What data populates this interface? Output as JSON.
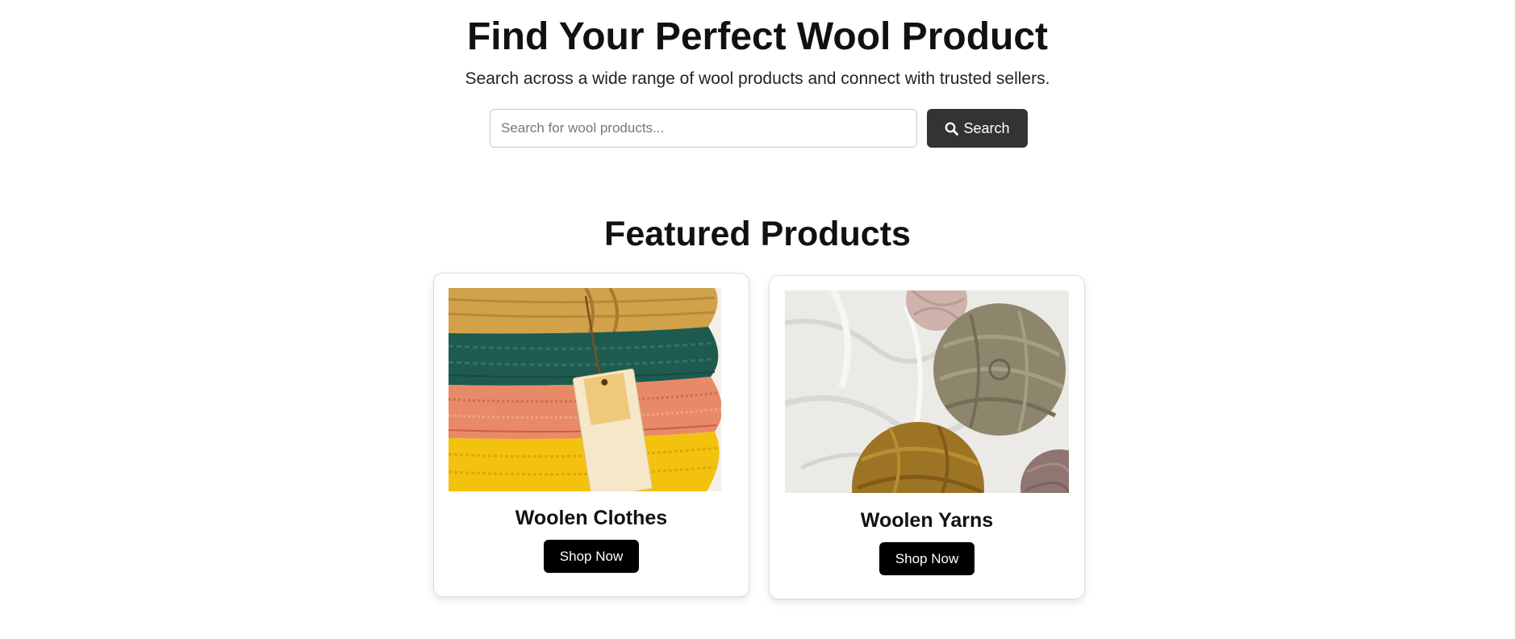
{
  "hero": {
    "title": "Find Your Perfect Wool Product",
    "subtitle": "Search across a wide range of wool products and connect with trusted sellers."
  },
  "search": {
    "placeholder": "Search for wool products...",
    "value": "",
    "button_label": "Search",
    "button_icon": "search-icon"
  },
  "featured": {
    "title": "Featured Products",
    "products": [
      {
        "name": "Woolen Clothes",
        "button_label": "Shop Now"
      },
      {
        "name": "Woolen Yarns",
        "button_label": "Shop Now"
      }
    ]
  },
  "colors": {
    "search_button_bg": "#333333",
    "shop_button_bg": "#000000",
    "text": "#111111"
  }
}
